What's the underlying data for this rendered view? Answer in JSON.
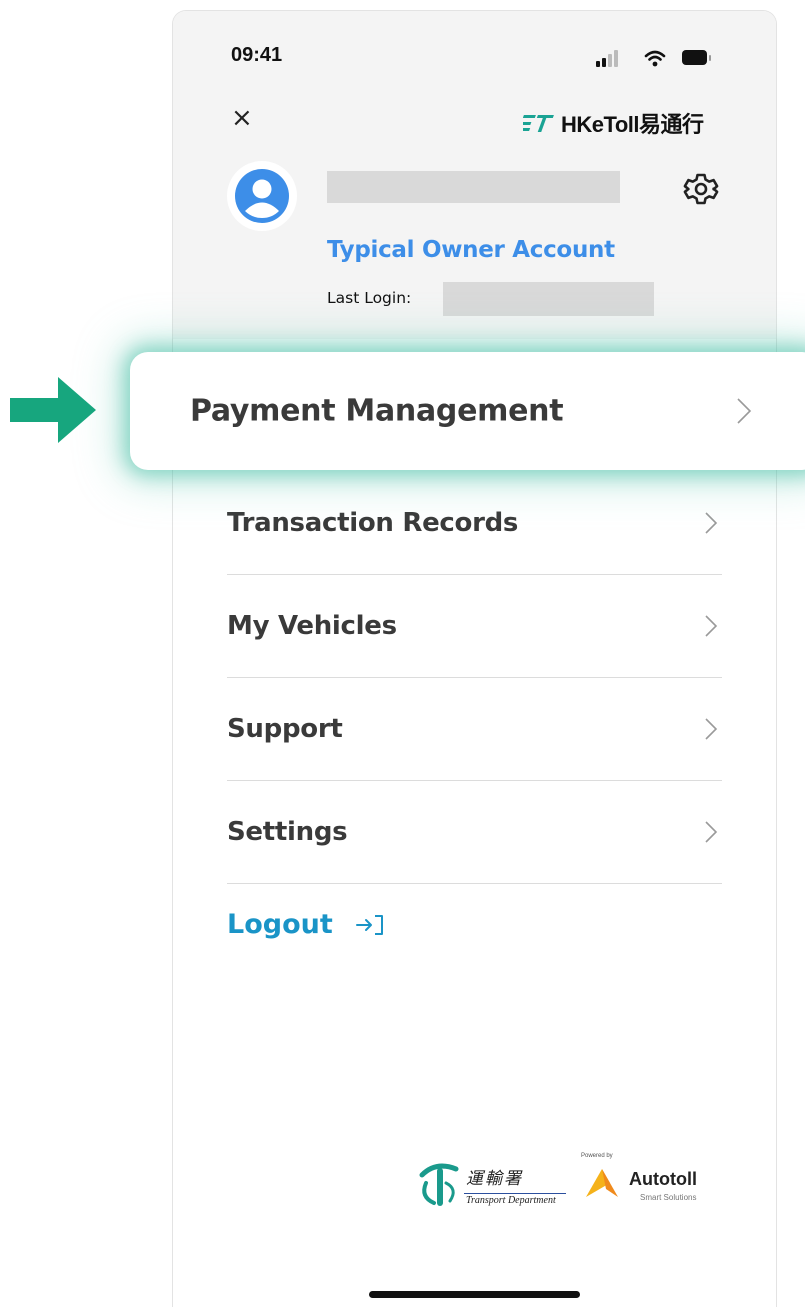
{
  "status_bar": {
    "time": "09:41",
    "icons": [
      "signal-icon",
      "wifi-icon",
      "battery-icon"
    ]
  },
  "header": {
    "close_icon": "×",
    "brand": {
      "logo_mark": "ET",
      "name": "HKeToll易通行"
    }
  },
  "profile": {
    "account_type": "Typical Owner Account",
    "last_login_label": "Last Login:"
  },
  "menu": {
    "highlighted": "Payment Management",
    "items": [
      "Transaction Records",
      "My Vehicles",
      "Support",
      "Settings"
    ]
  },
  "logout": {
    "label": "Logout"
  },
  "footer": {
    "transport_department": {
      "chinese": "運輸署",
      "english": "Transport Department"
    },
    "autotoll": {
      "powered_by": "Powered by",
      "name": "Autotoll",
      "tagline": "Smart Solutions"
    }
  },
  "colors": {
    "accent_blue": "#3d8ee8",
    "logout_blue": "#1a94c7",
    "highlight_glow": "#28b496",
    "arrow_green": "#17a67e",
    "brand_teal": "#1aa394"
  }
}
